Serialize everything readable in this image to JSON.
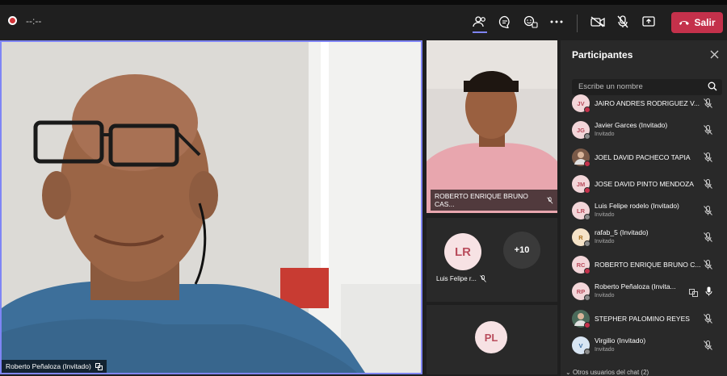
{
  "meeting": {
    "timer": "--:--",
    "leave_label": "Salir"
  },
  "main_video": {
    "name": "Roberto Peñaloza (Invitado)"
  },
  "tiles": {
    "top_name": "ROBERTO ENRIQUE BRUNO CAS...",
    "mid_avatar": "LR",
    "mid_name": "Luis Felipe r...",
    "overflow_count": "+10",
    "bottom_avatar": "PL"
  },
  "panel": {
    "title": "Participantes",
    "search_placeholder": "Escribe un nombre",
    "participants": [
      {
        "initials": "JV",
        "name": "JAIRO ANDRES RODRIGUEZ V...",
        "sub": "",
        "status": "#c4314b"
      },
      {
        "initials": "JG",
        "name": "Javier Garces (Invitado)",
        "sub": "Invitado",
        "status": "#8a8a8a"
      },
      {
        "initials": "",
        "name": "JOEL DAVID PACHECO TAPIA",
        "sub": "",
        "status": "#c4314b"
      },
      {
        "initials": "JM",
        "name": "JOSE DAVID PINTO MENDOZA",
        "sub": "",
        "status": "#c4314b"
      },
      {
        "initials": "LR",
        "name": "Luis Felipe rodelo (Invitado)",
        "sub": "Invitado",
        "status": "#8a8a8a"
      },
      {
        "initials": "R",
        "name": "rafab_5 (Invitado)",
        "sub": "Invitado",
        "status": "#8a8a8a"
      },
      {
        "initials": "RC",
        "name": "ROBERTO ENRIQUE BRUNO C...",
        "sub": "",
        "status": "#c4314b"
      },
      {
        "initials": "RP",
        "name": "Roberto Peñaloza (Invita...",
        "sub": "Invitado",
        "status": "#8a8a8a"
      },
      {
        "initials": "",
        "name": "STEPHER PALOMINO REYES",
        "sub": "",
        "status": "#c4314b"
      },
      {
        "initials": "V",
        "name": "Virgilio (Invitado)",
        "sub": "Invitado",
        "status": "#8a8a8a"
      }
    ],
    "footer": "Otros usuarios del chat (2)"
  },
  "colors": {
    "accent": "#7f85f5",
    "leave": "#c4314b"
  }
}
